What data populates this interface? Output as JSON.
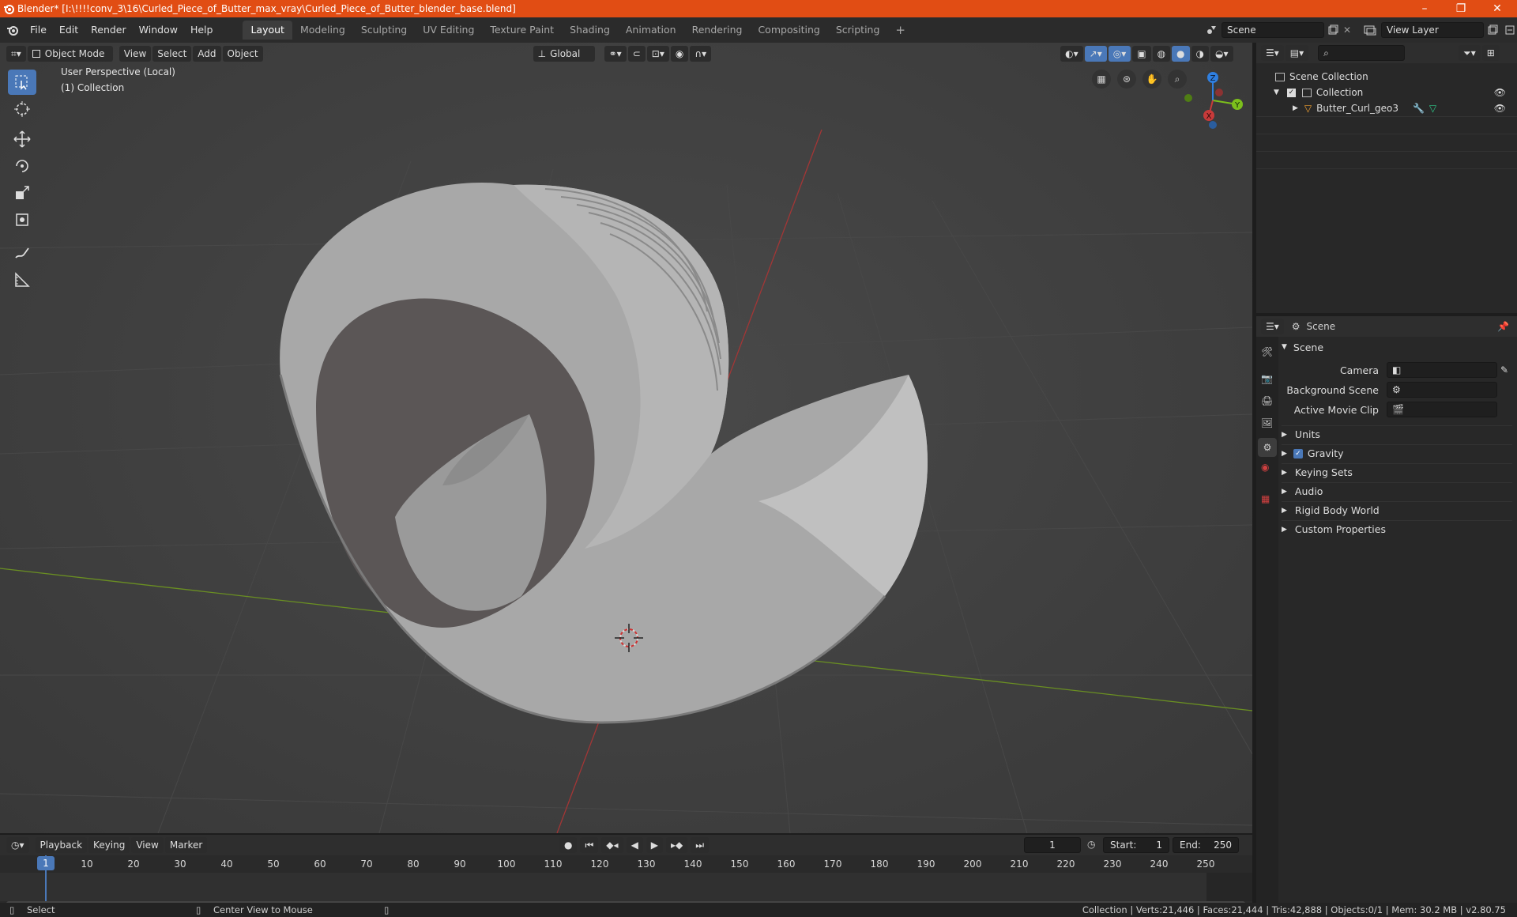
{
  "window": {
    "title": "Blender* [I:\\!!!!conv_3\\16\\Curled_Piece_of_Butter_max_vray\\Curled_Piece_of_Butter_blender_base.blend]",
    "controls": {
      "minimize": "–",
      "maximize": "❐",
      "close": "✕"
    }
  },
  "menubar": {
    "items": [
      "File",
      "Edit",
      "Render",
      "Window",
      "Help"
    ],
    "workspaces": [
      "Layout",
      "Modeling",
      "Sculpting",
      "UV Editing",
      "Texture Paint",
      "Shading",
      "Animation",
      "Rendering",
      "Compositing",
      "Scripting"
    ],
    "add_workspace": "+",
    "scene": "Scene",
    "view_layer": "View Layer"
  },
  "viewport": {
    "mode": "Object Mode",
    "menus": [
      "View",
      "Select",
      "Add",
      "Object"
    ],
    "orientation": "Global",
    "overlay_title": "User Perspective (Local)",
    "overlay_collection": "(1) Collection",
    "gizmo": {
      "z": "Z",
      "y": "Y",
      "x": "X"
    }
  },
  "outliner": {
    "search_placeholder": "",
    "root": "Scene Collection",
    "collection": "Collection",
    "object": "Butter_Curl_geo3"
  },
  "properties": {
    "context": "Scene",
    "section": "Scene",
    "camera_label": "Camera",
    "background_scene_label": "Background Scene",
    "active_movie_clip_label": "Active Movie Clip",
    "panels": [
      "Units",
      "Gravity",
      "Keying Sets",
      "Audio",
      "Rigid Body World",
      "Custom Properties"
    ]
  },
  "timeline": {
    "menus": [
      "Playback",
      "Keying",
      "View",
      "Marker"
    ],
    "current_frame": "1",
    "start_label": "Start:",
    "start": "1",
    "end_label": "End:",
    "end": "250",
    "ticks": [
      "1",
      "10",
      "20",
      "30",
      "40",
      "50",
      "60",
      "70",
      "80",
      "90",
      "100",
      "110",
      "120",
      "130",
      "140",
      "150",
      "160",
      "170",
      "180",
      "190",
      "200",
      "210",
      "220",
      "230",
      "240",
      "250"
    ]
  },
  "status": {
    "left_action": "Select",
    "mid_action": "Center View to Mouse",
    "stats": "Collection | Verts:21,446 | Faces:21,444 | Tris:42,888 | Objects:0/1 | Mem: 30.2 MB | v2.80.75"
  },
  "colors": {
    "title_bar": "#e14d14",
    "accent": "#4a78b8",
    "x_axis": "#c83a3a",
    "y_axis": "#7cbf1c",
    "z_axis": "#2f7fe0"
  }
}
